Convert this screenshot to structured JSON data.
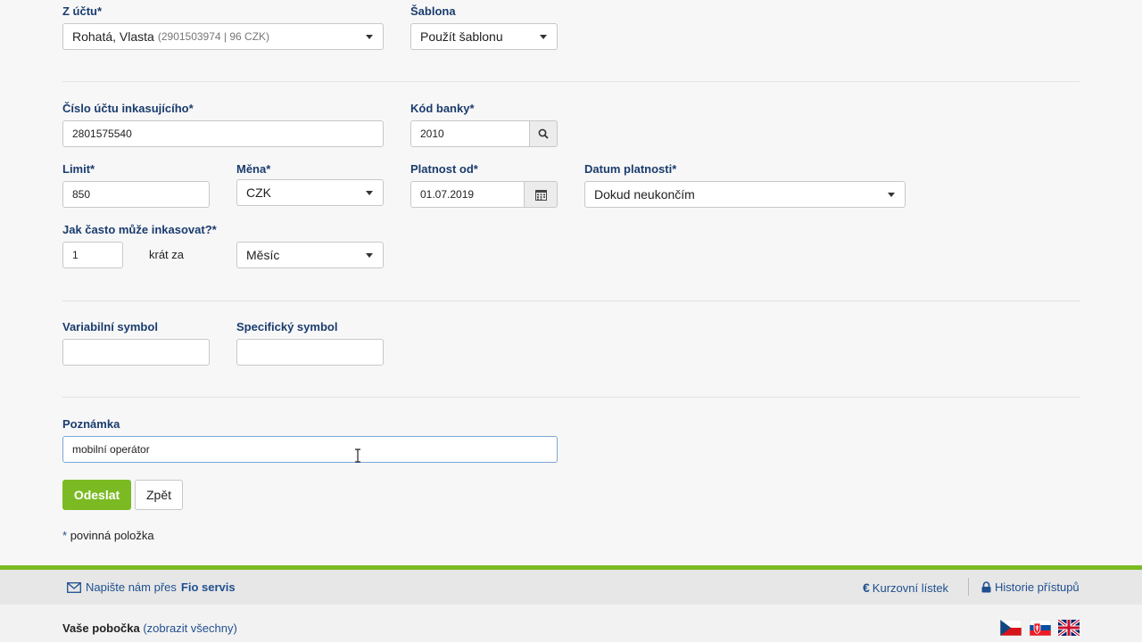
{
  "account": {
    "label": "Z účtu*",
    "value": "Rohatá, Vlasta",
    "detail": "(2901503974   |   96 CZK)"
  },
  "template": {
    "label": "Šablona",
    "value": "Použít šablonu"
  },
  "collector_account": {
    "label": "Číslo účtu inkasujícího*",
    "value": "2801575540"
  },
  "bank_code": {
    "label": "Kód banky*",
    "value": "2010",
    "search_icon": "search-icon"
  },
  "limit": {
    "label": "Limit*",
    "value": "850"
  },
  "currency": {
    "label": "Měna*",
    "value": "CZK"
  },
  "valid_from": {
    "label": "Platnost od*",
    "value": "01.07.2019",
    "calendar_icon": "calendar-icon"
  },
  "valid_until": {
    "label": "Datum platnosti*",
    "value": "Dokud neukončím"
  },
  "frequency": {
    "label": "Jak často může inkasovat?*",
    "count": "1",
    "times_per": "krát za",
    "period": "Měsíc"
  },
  "variable_symbol": {
    "label": "Variabilní symbol",
    "value": ""
  },
  "specific_symbol": {
    "label": "Specifický symbol",
    "value": ""
  },
  "note": {
    "label": "Poznámka",
    "value": "mobilní operátor"
  },
  "buttons": {
    "submit": "Odeslat",
    "back": "Zpět"
  },
  "required_note": {
    "star": "*",
    "text": "povinná položka"
  },
  "footer": {
    "write_us_prefix": "Napište nám přes",
    "write_us_link": "Fio servis",
    "exchange_rates": "Kurzovní lístek",
    "access_history": "Historie přístupů",
    "branch_label": "Vaše pobočka",
    "branch_link": "(zobrazit všechny)"
  },
  "languages": [
    "cs",
    "sk",
    "en"
  ],
  "colors": {
    "accent_green": "#7cba23",
    "label_blue": "#1a3c6e",
    "link_blue": "#1f4f8f"
  }
}
